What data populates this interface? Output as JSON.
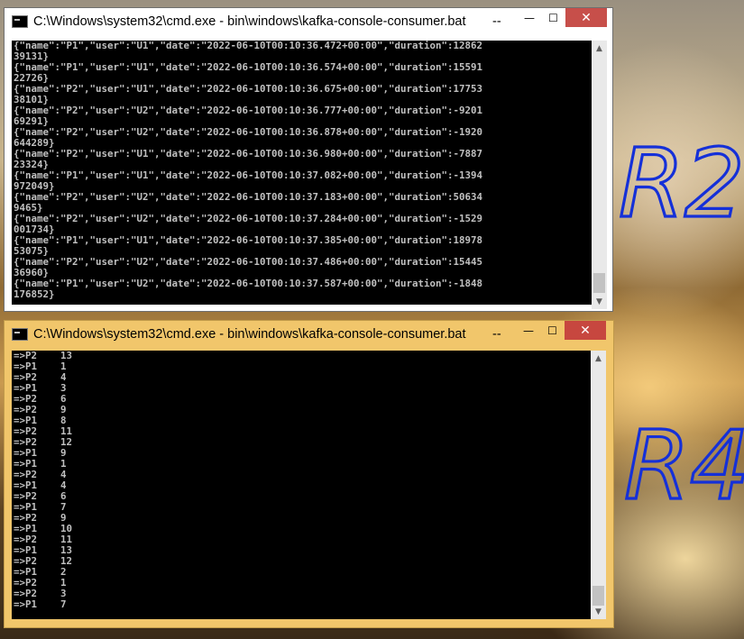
{
  "windows": [
    {
      "title": "C:\\Windows\\system32\\cmd.exe - bin\\windows\\kafka-console-consumer.bat",
      "buttons": {
        "minimize": "—",
        "maximize": "☐",
        "close": "✕",
        "overflow": "--"
      },
      "lines": [
        "{\"name\":\"P1\",\"user\":\"U1\",\"date\":\"2022-06-10T00:10:36.472+00:00\",\"duration\":12862",
        "39131}",
        "{\"name\":\"P1\",\"user\":\"U1\",\"date\":\"2022-06-10T00:10:36.574+00:00\",\"duration\":15591",
        "22726}",
        "{\"name\":\"P2\",\"user\":\"U1\",\"date\":\"2022-06-10T00:10:36.675+00:00\",\"duration\":17753",
        "38101}",
        "{\"name\":\"P2\",\"user\":\"U2\",\"date\":\"2022-06-10T00:10:36.777+00:00\",\"duration\":-9201",
        "69291}",
        "{\"name\":\"P2\",\"user\":\"U2\",\"date\":\"2022-06-10T00:10:36.878+00:00\",\"duration\":-1920",
        "644289}",
        "{\"name\":\"P2\",\"user\":\"U1\",\"date\":\"2022-06-10T00:10:36.980+00:00\",\"duration\":-7887",
        "23324}",
        "{\"name\":\"P1\",\"user\":\"U1\",\"date\":\"2022-06-10T00:10:37.082+00:00\",\"duration\":-1394",
        "972049}",
        "{\"name\":\"P2\",\"user\":\"U2\",\"date\":\"2022-06-10T00:10:37.183+00:00\",\"duration\":50634",
        "9465}",
        "{\"name\":\"P2\",\"user\":\"U2\",\"date\":\"2022-06-10T00:10:37.284+00:00\",\"duration\":-1529",
        "001734}",
        "{\"name\":\"P1\",\"user\":\"U1\",\"date\":\"2022-06-10T00:10:37.385+00:00\",\"duration\":18978",
        "53075}",
        "{\"name\":\"P2\",\"user\":\"U2\",\"date\":\"2022-06-10T00:10:37.486+00:00\",\"duration\":15445",
        "36960}",
        "{\"name\":\"P1\",\"user\":\"U2\",\"date\":\"2022-06-10T00:10:37.587+00:00\",\"duration\":-1848",
        "176852}"
      ]
    },
    {
      "title": "C:\\Windows\\system32\\cmd.exe - bin\\windows\\kafka-console-consumer.bat",
      "buttons": {
        "minimize": "—",
        "maximize": "☐",
        "close": "✕",
        "overflow": "--"
      },
      "lines": [
        "=>P2    13",
        "=>P1    1",
        "=>P2    4",
        "=>P1    3",
        "=>P2    6",
        "=>P2    9",
        "=>P1    8",
        "=>P2    11",
        "=>P2    12",
        "=>P1    9",
        "=>P1    1",
        "=>P2    4",
        "=>P1    4",
        "=>P2    6",
        "=>P1    7",
        "=>P2    9",
        "=>P1    10",
        "=>P2    11",
        "=>P1    13",
        "=>P2    12",
        "=>P1    2",
        "=>P2    1",
        "=>P2    3",
        "=>P1    7"
      ]
    }
  ],
  "annotations": {
    "top": "R2",
    "bottom": "R4",
    "color": "#1530d8"
  },
  "scroll_arrows": {
    "up": "▲",
    "down": "▼"
  }
}
